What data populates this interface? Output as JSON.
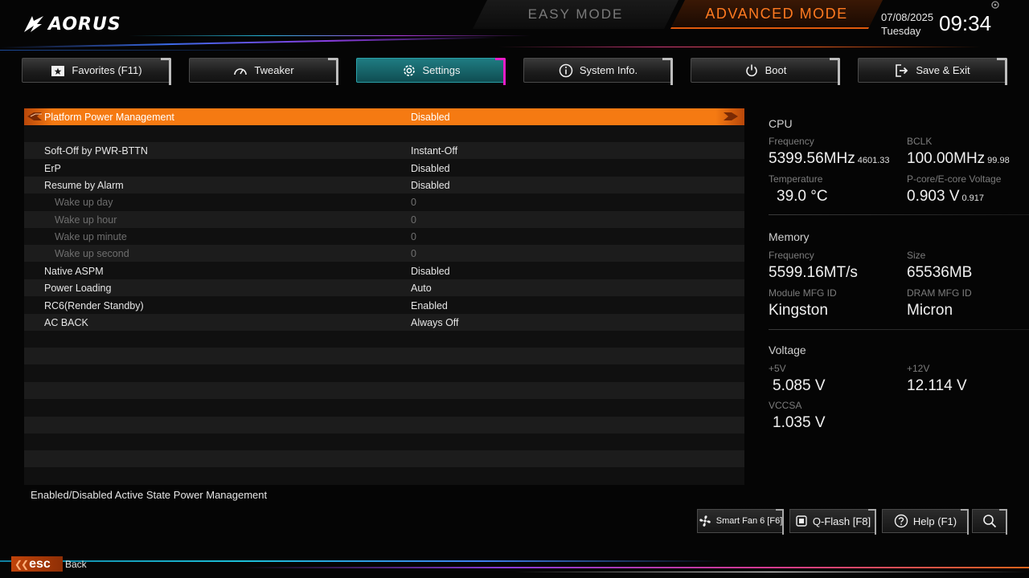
{
  "header": {
    "logo_text": "AORUS",
    "mode_easy": "EASY MODE",
    "mode_advanced": "ADVANCED MODE",
    "date": "07/08/2025",
    "weekday": "Tuesday",
    "time": "09:34"
  },
  "nav": {
    "tabs": [
      {
        "label": "Favorites (F11)",
        "icon": "star-folder-icon"
      },
      {
        "label": "Tweaker",
        "icon": "speedometer-icon"
      },
      {
        "label": "Settings",
        "icon": "gear-icon",
        "active": true
      },
      {
        "label": "System Info.",
        "icon": "info-icon"
      },
      {
        "label": "Boot",
        "icon": "power-icon"
      },
      {
        "label": "Save & Exit",
        "icon": "exit-icon"
      }
    ]
  },
  "settings": {
    "rows": [
      {
        "name": "Platform Power Management",
        "value": "Disabled",
        "selected": true
      },
      {
        "name": "",
        "value": ""
      },
      {
        "name": "Soft-Off by PWR-BTTN",
        "value": "Instant-Off"
      },
      {
        "name": "ErP",
        "value": "Disabled"
      },
      {
        "name": "Resume by Alarm",
        "value": "Disabled"
      },
      {
        "name": "Wake up day",
        "value": "0",
        "sub": true
      },
      {
        "name": "Wake up hour",
        "value": "0",
        "sub": true
      },
      {
        "name": "Wake up minute",
        "value": "0",
        "sub": true
      },
      {
        "name": "Wake up second",
        "value": "0",
        "sub": true
      },
      {
        "name": "Native ASPM",
        "value": "Disabled"
      },
      {
        "name": "Power Loading",
        "value": "Auto"
      },
      {
        "name": "RC6(Render Standby)",
        "value": "Enabled"
      },
      {
        "name": "AC BACK",
        "value": "Always Off"
      }
    ],
    "help_text": "Enabled/Disabled Active State Power Management"
  },
  "info": {
    "cpu": {
      "title": "CPU",
      "freq_label": "Frequency",
      "freq_value": "5399.56MHz",
      "freq_sub": "4601.33",
      "bclk_label": "BCLK",
      "bclk_value": "100.00MHz",
      "bclk_sub": "99.98",
      "temp_label": "Temperature",
      "temp_value": "39.0 °C",
      "volt_label": "P-core/E-core Voltage",
      "volt_value": "0.903 V",
      "volt_sub": "0.917"
    },
    "memory": {
      "title": "Memory",
      "freq_label": "Frequency",
      "freq_value": "5599.16MT/s",
      "size_label": "Size",
      "size_value": "65536MB",
      "module_label": "Module MFG ID",
      "module_value": "Kingston",
      "dram_label": "DRAM MFG ID",
      "dram_value": "Micron"
    },
    "voltage": {
      "title": "Voltage",
      "v5_label": "+5V",
      "v5_value": "5.085 V",
      "v12_label": "+12V",
      "v12_value": "12.114 V",
      "vccsa_label": "VCCSA",
      "vccsa_value": "1.035 V"
    }
  },
  "footer": {
    "smart_fan": "Smart Fan 6 [F6]",
    "qflash": "Q-Flash [F8]",
    "help": "Help (F1)",
    "esc_label": "esc",
    "back_label": "Back"
  },
  "colors": {
    "accent_orange": "#f57a12",
    "accent_teal": "#1f7c82",
    "accent_magenta": "#e81ec8"
  }
}
